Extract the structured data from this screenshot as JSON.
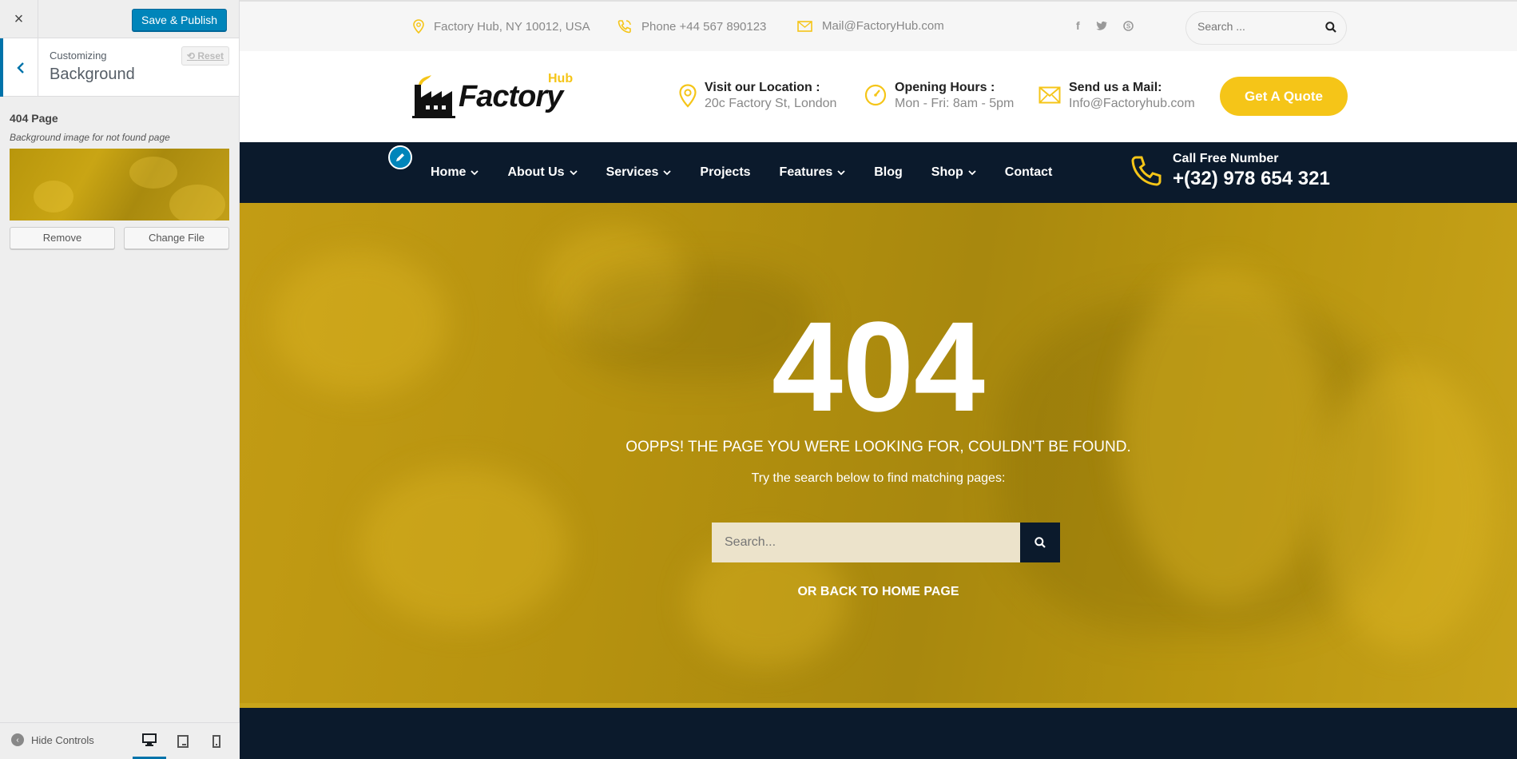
{
  "customizer": {
    "close_label": "×",
    "publish_label": "Save & Publish",
    "subtitle": "Customizing",
    "title": "Background",
    "reset_label": "Reset",
    "setting_label": "404 Page",
    "setting_description": "Background image for not found page",
    "remove_label": "Remove",
    "change_label": "Change File",
    "hide_controls_label": "Hide Controls",
    "devices": [
      "desktop-icon",
      "tablet-icon",
      "mobile-icon"
    ]
  },
  "topbar": {
    "address": "Factory Hub, NY 10012, USA",
    "phone": "Phone +44 567 890123",
    "email": "Mail@FactoryHub.com",
    "social": [
      "facebook-icon",
      "twitter-icon",
      "skype-icon"
    ],
    "search_placeholder": "Search ..."
  },
  "header": {
    "logo_text": "Factory",
    "logo_hub": "Hub",
    "location_title": "Visit our Location :",
    "location_value": "20c Factory St, London",
    "hours_title": "Opening Hours :",
    "hours_value": "Mon - Fri: 8am - 5pm",
    "mail_title": "Send us a Mail:",
    "mail_value": "Info@Factoryhub.com",
    "quote_label": "Get A Quote"
  },
  "nav": {
    "items": [
      {
        "label": "Home",
        "dropdown": true
      },
      {
        "label": "About Us",
        "dropdown": true
      },
      {
        "label": "Services",
        "dropdown": true
      },
      {
        "label": "Projects",
        "dropdown": false
      },
      {
        "label": "Features",
        "dropdown": true
      },
      {
        "label": "Blog",
        "dropdown": false
      },
      {
        "label": "Shop",
        "dropdown": true
      },
      {
        "label": "Contact",
        "dropdown": false
      }
    ],
    "call_title": "Call Free Number",
    "call_number": "+(32) 978 654 321"
  },
  "hero": {
    "code": "404",
    "message": "OOPPS! THE PAGE YOU WERE LOOKING FOR, COULDN'T BE FOUND.",
    "try_text": "Try the search below to find matching pages:",
    "search_placeholder": "Search...",
    "back_label": "OR BACK TO HOME PAGE"
  },
  "colors": {
    "accent": "#f5c518",
    "navy": "#0b1a2c",
    "wp_blue": "#0085ba"
  }
}
